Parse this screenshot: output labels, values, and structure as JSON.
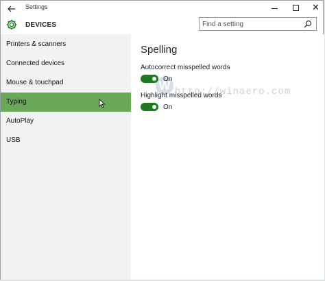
{
  "window": {
    "title": "Settings"
  },
  "header": {
    "section": "DEVICES",
    "search_placeholder": "Find a setting"
  },
  "sidebar": {
    "items": [
      {
        "label": "Printers & scanners",
        "selected": false
      },
      {
        "label": "Connected devices",
        "selected": false
      },
      {
        "label": "Mouse & touchpad",
        "selected": false
      },
      {
        "label": "Typing",
        "selected": true
      },
      {
        "label": "AutoPlay",
        "selected": false
      },
      {
        "label": "USB",
        "selected": false
      }
    ]
  },
  "main": {
    "heading": "Spelling",
    "settings": [
      {
        "label": "Autocorrect misspelled words",
        "state": "On"
      },
      {
        "label": "Highlight misspelled words",
        "state": "On"
      }
    ]
  },
  "watermark": {
    "text": "http://winaero.com",
    "logo_letter": "W"
  },
  "colors": {
    "accent": "#1d7a21",
    "selected_bg": "#6aa85a",
    "sidebar_bg": "#f2f2f2"
  },
  "icons": [
    "back-arrow-icon",
    "minimize-icon",
    "maximize-icon",
    "close-icon",
    "gear-icon",
    "search-icon",
    "mouse-cursor-icon"
  ]
}
